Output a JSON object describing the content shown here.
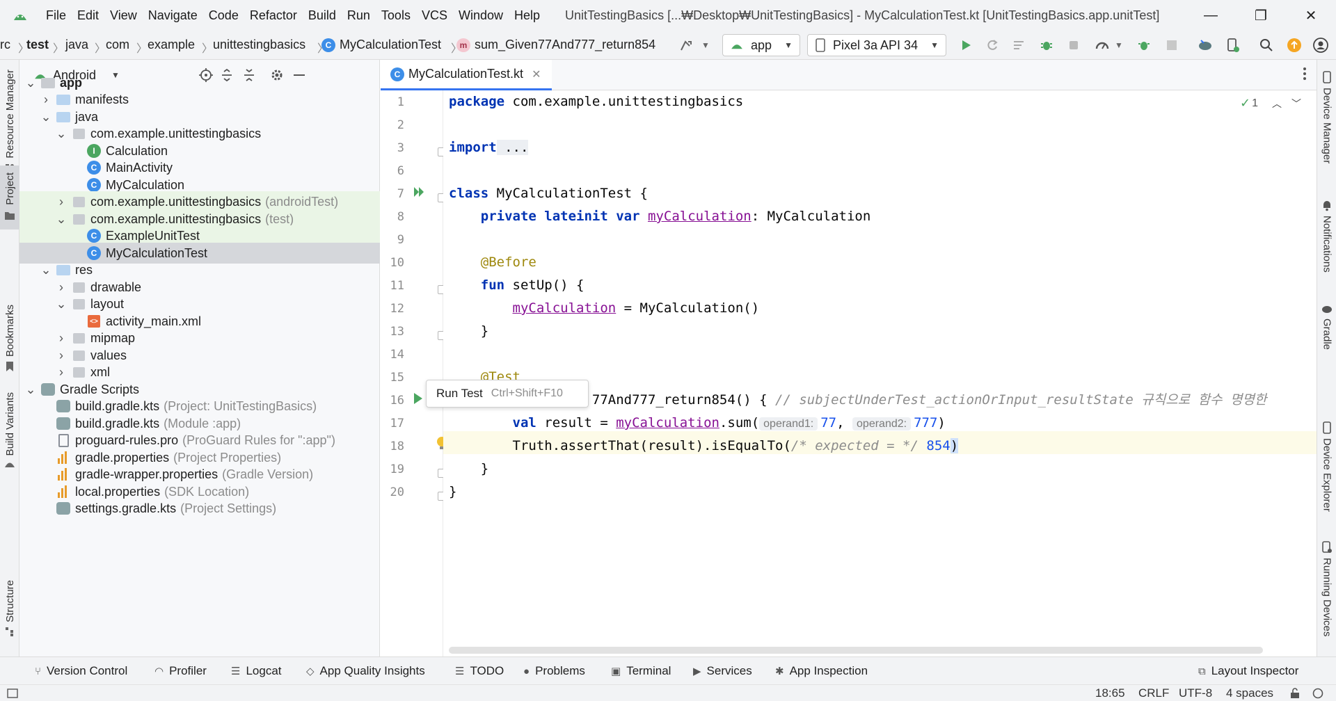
{
  "window": {
    "title": "UnitTestingBasics [...₩Desktop₩UnitTestingBasics] - MyCalculationTest.kt [UnitTestingBasics.app.unitTest]",
    "menu": [
      "File",
      "Edit",
      "View",
      "Navigate",
      "Code",
      "Refactor",
      "Build",
      "Run",
      "Tools",
      "VCS",
      "Window",
      "Help"
    ],
    "menu_mnemonic": [
      "F",
      "E",
      "V",
      "N",
      "C",
      "R",
      "B",
      "R",
      "T",
      "S",
      "W",
      "H"
    ]
  },
  "breadcrumb": [
    "rc",
    "test",
    "java",
    "com",
    "example",
    "unittestingbasics",
    "MyCalculationTest",
    "sum_Given77And777_return854"
  ],
  "toolbar": {
    "run_config": "app",
    "device": "Pixel 3a API 34"
  },
  "left_tabs": [
    "Resource Manager",
    "Project",
    "Bookmarks",
    "Build Variants",
    "Structure"
  ],
  "right_tabs": [
    "Device Manager",
    "Notifications",
    "Gradle",
    "Device Explorer",
    "Running Devices"
  ],
  "project_panel": {
    "view_mode": "Android",
    "tree": [
      {
        "label": "app",
        "extra": "",
        "indent": 0,
        "bold": true
      },
      {
        "label": "manifests",
        "extra": "",
        "indent": 1
      },
      {
        "label": "java",
        "extra": "",
        "indent": 1
      },
      {
        "label": "com.example.unittestingbasics",
        "extra": "",
        "indent": 2
      },
      {
        "label": "Calculation",
        "extra": "",
        "indent": 3
      },
      {
        "label": "MainActivity",
        "extra": "",
        "indent": 3
      },
      {
        "label": "MyCalculation",
        "extra": "",
        "indent": 3
      },
      {
        "label": "com.example.unittestingbasics",
        "extra": "(androidTest)",
        "indent": 2
      },
      {
        "label": "com.example.unittestingbasics",
        "extra": "(test)",
        "indent": 2
      },
      {
        "label": "ExampleUnitTest",
        "extra": "",
        "indent": 3
      },
      {
        "label": "MyCalculationTest",
        "extra": "",
        "indent": 3
      },
      {
        "label": "res",
        "extra": "",
        "indent": 1
      },
      {
        "label": "drawable",
        "extra": "",
        "indent": 2
      },
      {
        "label": "layout",
        "extra": "",
        "indent": 2
      },
      {
        "label": "activity_main.xml",
        "extra": "",
        "indent": 3
      },
      {
        "label": "mipmap",
        "extra": "",
        "indent": 2
      },
      {
        "label": "values",
        "extra": "",
        "indent": 2
      },
      {
        "label": "xml",
        "extra": "",
        "indent": 2
      },
      {
        "label": "Gradle Scripts",
        "extra": "",
        "indent": 0
      },
      {
        "label": "build.gradle.kts",
        "extra": "(Project: UnitTestingBasics)",
        "indent": 1
      },
      {
        "label": "build.gradle.kts",
        "extra": "(Module :app)",
        "indent": 1
      },
      {
        "label": "proguard-rules.pro",
        "extra": "(ProGuard Rules for \":app\")",
        "indent": 1
      },
      {
        "label": "gradle.properties",
        "extra": "(Project Properties)",
        "indent": 1
      },
      {
        "label": "gradle-wrapper.properties",
        "extra": "(Gradle Version)",
        "indent": 1
      },
      {
        "label": "local.properties",
        "extra": "(SDK Location)",
        "indent": 1
      },
      {
        "label": "settings.gradle.kts",
        "extra": "(Project Settings)",
        "indent": 1
      }
    ]
  },
  "editor": {
    "tab_label": "MyCalculationTest.kt",
    "inspection_count": "1",
    "line_numbers": [
      "1",
      "2",
      "3",
      "6",
      "7",
      "8",
      "9",
      "10",
      "11",
      "12",
      "13",
      "14",
      "15",
      "16",
      "17",
      "18",
      "19",
      "20"
    ],
    "code": {
      "l1_kw": "package",
      "l1_rest": " com.example.unittestingbasics",
      "l3_kw": "import",
      "l3_rest": " ...",
      "l7_kw": "class",
      "l7_rest": " MyCalculationTest {",
      "l8_kw": "private lateinit var",
      "l8_prop": "myCalculation",
      "l8_rest": ": MyCalculation",
      "l10_ann": "@Before",
      "l11_kw": "fun",
      "l11_rest": " setUp() {",
      "l12_prop": "myCalculation",
      "l12_rest": " = MyCalculation()",
      "l13": "}",
      "l15_ann": "@Test",
      "l16_rest": "77And777_return854() { ",
      "l16_cmt": "// subjectUnderTest_actionOrInput_resultState 규칙으로 함수 명명한",
      "l17_kw": "val",
      "l17_mid": " result = ",
      "l17_prop": "myCalculation",
      "l17_call": ".sum(",
      "l17_hint1": "operand1:",
      "l17_num1": "77",
      "l17_comma": ",",
      "l17_hint2": "operand2:",
      "l17_num2": "777",
      "l17_close": ")",
      "l18_pre": "Truth.assertThat(result).isEqualTo(",
      "l18_cmt": "/* expected = */",
      "l18_num": "854",
      "l18_close": ")",
      "l19": "}",
      "l20": "}"
    },
    "tooltip": {
      "action": "Run Test",
      "shortcut": "Ctrl+Shift+F10"
    }
  },
  "bottom_tools": [
    "Version Control",
    "Profiler",
    "Logcat",
    "App Quality Insights",
    "TODO",
    "Problems",
    "Terminal",
    "Services",
    "App Inspection",
    "Layout Inspector"
  ],
  "status": {
    "position": "18:65",
    "line_sep": "CRLF",
    "encoding": "UTF-8",
    "indent": "4 spaces"
  },
  "colors": {
    "accent": "#3574f0",
    "run_green": "#4ba660",
    "keyword": "#0033b3",
    "annotation": "#9e880d",
    "property": "#871094"
  }
}
